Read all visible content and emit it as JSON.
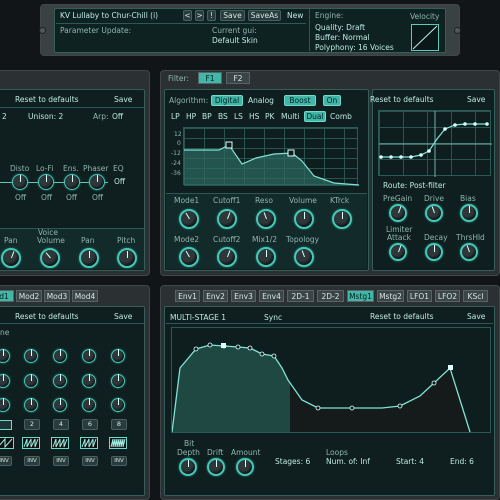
{
  "header": {
    "preset": "KV Lullaby to Chur-Chill (i)",
    "nav": [
      "<",
      ">",
      "!"
    ],
    "save": "Save",
    "saveas": "SaveAs",
    "new": "New",
    "param_update": "Parameter Update:",
    "current_gui_label": "Current gui:",
    "current_gui_value": "Default Skin",
    "engine": "Engine:",
    "quality": "Quality: Draft",
    "buffer": "Buffer: Normal",
    "polyphony": "Polyphony: 16 Voices",
    "velocity": "Velocity"
  },
  "left_top": {
    "reset": "Reset to defaults",
    "save": "Save",
    "voice_val": "2",
    "unison": "Unison: 2",
    "arp": "Arp:",
    "arp_val": "Off",
    "fx": [
      {
        "label": "Disto",
        "val": "Off"
      },
      {
        "label": "Lo-Fi",
        "val": "Off"
      },
      {
        "label": "Ens.",
        "val": "Off"
      },
      {
        "label": "Phaser",
        "val": "Off"
      },
      {
        "label": "EQ",
        "val": "Off"
      }
    ],
    "voice_section": "Voice",
    "bottom": [
      "Pan",
      "Volume",
      "Pan",
      "Pitch"
    ]
  },
  "filter": {
    "label": "Filter:",
    "tabs": [
      "F1",
      "F2"
    ],
    "algorithm": "Algorithm:",
    "algos": [
      "Digital",
      "Analog"
    ],
    "boost": "Boost",
    "on": "On",
    "types": [
      "LP",
      "HP",
      "BP",
      "BS",
      "LS",
      "HS",
      "PK",
      "Multi",
      "Dual",
      "Comb"
    ],
    "db": [
      "12",
      "0",
      "-12",
      "-24",
      "-36"
    ],
    "knobs_row1": [
      "Mode1",
      "Cutoff1",
      "Reso",
      "Volume",
      "KTrck"
    ],
    "knobs_row2": [
      "Mode2",
      "Cutoff2",
      "Mix1/2",
      "Topology"
    ],
    "reset": "Reset to defaults",
    "save": "Save",
    "route": "Route: Post-filter",
    "drive_knobs": [
      "PreGain",
      "Drive",
      "Bias"
    ],
    "limiter": [
      "Limiter\nAttack",
      "Decay",
      "ThrsHld"
    ]
  },
  "mod": {
    "tabs": [
      "d1",
      "Mod2",
      "Mod3",
      "Mod4"
    ],
    "reset": "Reset to defaults",
    "save": "Save",
    "row_label": "ne",
    "steps": [
      "2",
      "4",
      "6",
      "8",
      "2"
    ],
    "inv": "INV"
  },
  "env": {
    "tabs": [
      "Env1",
      "Env2",
      "Env3",
      "Env4",
      "2D-1",
      "2D-2",
      "Mstg1",
      "Mstg2",
      "LFO1",
      "LFO2",
      "KScl"
    ],
    "title": "MULTI-STAGE 1",
    "sync": "Sync",
    "reset": "Reset to defaults",
    "save": "Save",
    "bit_depth": "Bit\nDepth",
    "drift": "Drift",
    "amount": "Amount",
    "stages": "Stages: 6",
    "loops": "Loops",
    "num_of": "Num. of: Inf",
    "start": "Start: 4",
    "end": "End: 6"
  }
}
